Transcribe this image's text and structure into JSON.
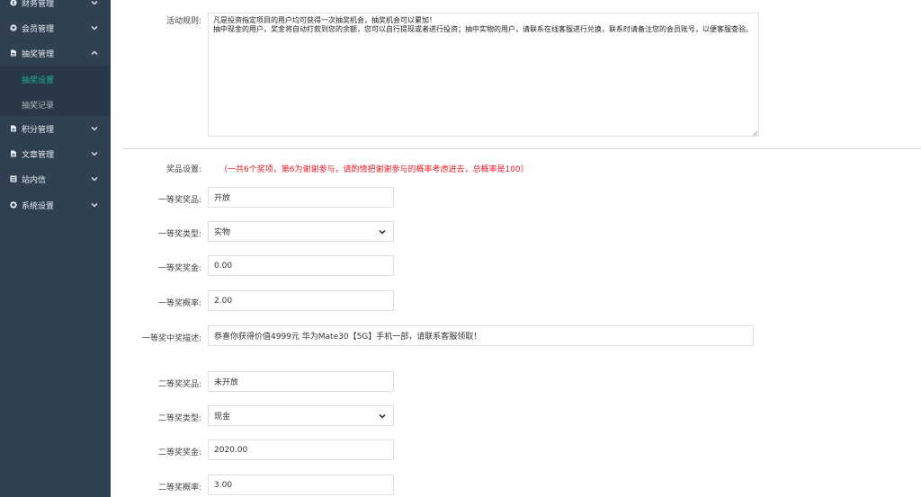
{
  "sidebar": {
    "items": [
      {
        "label": "财务管理",
        "icon": "circle-icon"
      },
      {
        "label": "会员管理",
        "icon": "heart-icon"
      },
      {
        "label": "抽奖管理",
        "icon": "file-icon"
      },
      {
        "label": "积分管理",
        "icon": "file-icon"
      },
      {
        "label": "文章管理",
        "icon": "file-icon"
      },
      {
        "label": "站内信",
        "icon": "list-icon"
      },
      {
        "label": "系统设置",
        "icon": "gear-icon"
      }
    ],
    "sub_items": [
      {
        "label": "抽奖设置",
        "current": true
      },
      {
        "label": "抽奖记录",
        "current": false
      }
    ],
    "accent_color": "#1ab394",
    "bg_color": "#2f4050"
  },
  "form": {
    "rules_label": "活动规则:",
    "rules_text_line1": "凡是投资指定项目的用户均可获得一次抽奖机会，抽奖机会可以累加！",
    "rules_text_line2": "抽中现金的用户，奖金将自动打款到您的余额，您可以自行提现或者进行投资；抽中实物的用户，请联系在线客服进行兑换，联系时请备注您的会员账号，以便客服查验。",
    "prize_label": "奖品设置:",
    "prize_note": "（一共6个奖项，第6为谢谢参与，请酌情把谢谢参与的概率考虑进去，总概率是100）",
    "first": {
      "prize_label": "一等奖奖品:",
      "prize_value": "开放",
      "type_label": "一等奖类型:",
      "type_value": "实物",
      "amount_label": "一等奖奖金:",
      "amount_value": "0.00",
      "prob_label": "一等奖概率:",
      "prob_value": "2.00",
      "desc_label": "一等奖中奖描述:",
      "desc_value": "恭喜你获得价值4999元  华为Mate30【5G】手机一部，请联系客服领取！"
    },
    "second": {
      "prize_label": "二等奖奖品:",
      "prize_value": "未开放",
      "type_label": "二等奖类型:",
      "type_value": "现金",
      "amount_label": "二等奖奖金:",
      "amount_value": "2020.00",
      "prob_label": "二等奖概率:",
      "prob_value": "3.00"
    }
  }
}
